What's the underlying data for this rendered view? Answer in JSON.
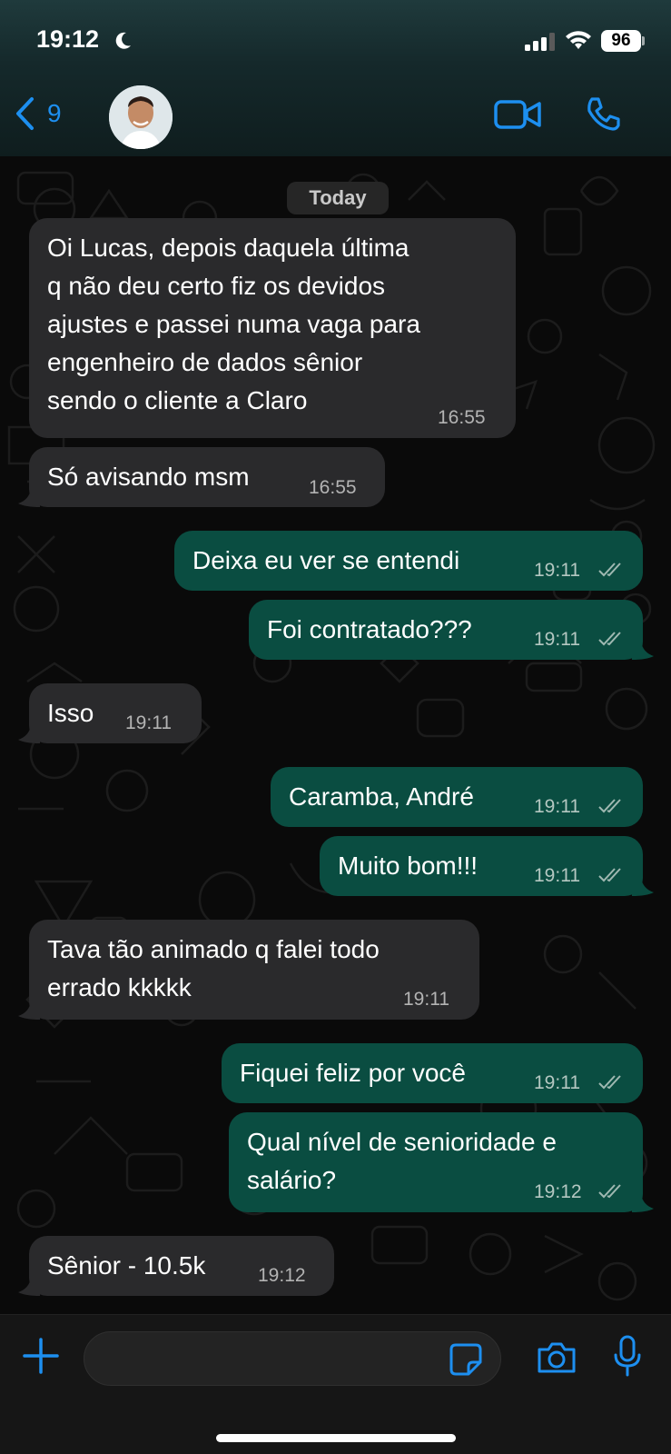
{
  "status_bar": {
    "time": "19:12",
    "battery": "96"
  },
  "header": {
    "back_count": "9",
    "contact_name": "",
    "accent_color": "#1d8ff0"
  },
  "chat": {
    "date_label": "Today",
    "messages": [
      {
        "direction": "in",
        "text": "Oi Lucas, depois daquela última\nq não deu certo fiz os devidos\najustes e passei numa vaga para\nengenheiro de dados sênior\nsendo o cliente a Claro",
        "time": "16:55"
      },
      {
        "direction": "in",
        "text": "Só avisando msm",
        "time": "16:55"
      },
      {
        "direction": "out",
        "text": "Deixa eu ver se entendi",
        "time": "19:11",
        "status": "read"
      },
      {
        "direction": "out",
        "text": "Foi contratado???",
        "time": "19:11",
        "status": "read"
      },
      {
        "direction": "in",
        "text": "Isso",
        "time": "19:11"
      },
      {
        "direction": "out",
        "text": "Caramba, André",
        "time": "19:11",
        "status": "read"
      },
      {
        "direction": "out",
        "text": "Muito bom!!!",
        "time": "19:11",
        "status": "read"
      },
      {
        "direction": "in",
        "text": "Tava tão animado q falei todo\nerrado kkkkk",
        "time": "19:11"
      },
      {
        "direction": "out",
        "text": "Fiquei feliz por você",
        "time": "19:11",
        "status": "read"
      },
      {
        "direction": "out",
        "text": "Qual nível de senioridade e\nsalário?",
        "time": "19:12",
        "status": "read"
      },
      {
        "direction": "in",
        "text": "Sênior - 10.5k",
        "time": "19:12"
      }
    ]
  },
  "input": {
    "value": "",
    "placeholder": ""
  },
  "colors": {
    "incoming_bubble": "#2a2a2c",
    "outgoing_bubble": "#0a4d41",
    "accent": "#1d8ff0"
  }
}
